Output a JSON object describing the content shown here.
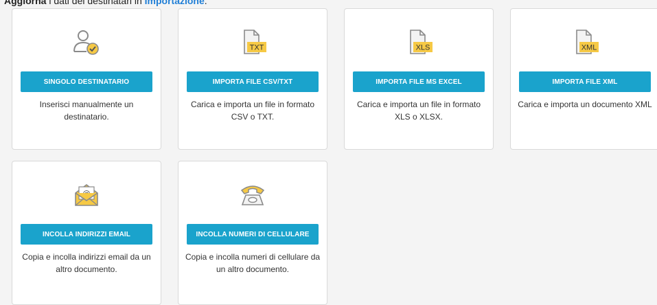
{
  "header": {
    "bold_text": "Aggiorna",
    "text": " i dati dei destinatari in ",
    "link_text": "Importazione",
    "suffix": "."
  },
  "cards": [
    {
      "button_label": "SINGOLO DESTINATARIO",
      "description": "Inserisci manualmente un destinatario.",
      "icon": "user-check-icon"
    },
    {
      "button_label": "IMPORTA FILE CSV/TXT",
      "description": "Carica e importa un file in formato CSV o TXT.",
      "icon": "txt-file-icon",
      "icon_text": "TXT"
    },
    {
      "button_label": "IMPORTA FILE MS EXCEL",
      "description": "Carica e importa un file in formato XLS o XLSX.",
      "icon": "xls-file-icon",
      "icon_text": "XLS"
    },
    {
      "button_label": "IMPORTA FILE XML",
      "description": "Carica e importa un documento XML",
      "icon": "xml-file-icon",
      "icon_text": "XML"
    },
    {
      "button_label": "INCOLLA INDIRIZZI EMAIL",
      "description": "Copia e incolla indirizzi email da un altro documento.",
      "icon": "email-envelope-icon"
    },
    {
      "button_label": "INCOLLA NUMERI DI CELLULARE",
      "description": "Copia e incolla numeri di cellulare da un altro documento.",
      "icon": "telephone-icon"
    }
  ],
  "colors": {
    "accent": "#1aa3cc",
    "icon_yellow": "#f6c945",
    "icon_gray": "#8a8a8a"
  }
}
